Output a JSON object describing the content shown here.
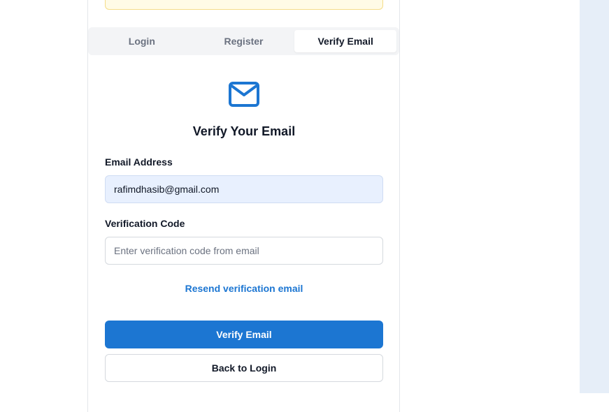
{
  "tabs": [
    {
      "label": "Login"
    },
    {
      "label": "Register"
    },
    {
      "label": "Verify Email"
    }
  ],
  "icon": {
    "name": "mail-icon",
    "color": "#1c76d2"
  },
  "form": {
    "title": "Verify Your Email",
    "email_label": "Email Address",
    "email_value": "rafimdhasib@gmail.com",
    "code_label": "Verification Code",
    "code_placeholder": "Enter verification code from email",
    "resend_link": "Resend verification email",
    "verify_button": "Verify Email",
    "back_button": "Back to Login"
  },
  "colors": {
    "accent": "#1c76d2",
    "autofill_bg": "#e8f0fe"
  }
}
